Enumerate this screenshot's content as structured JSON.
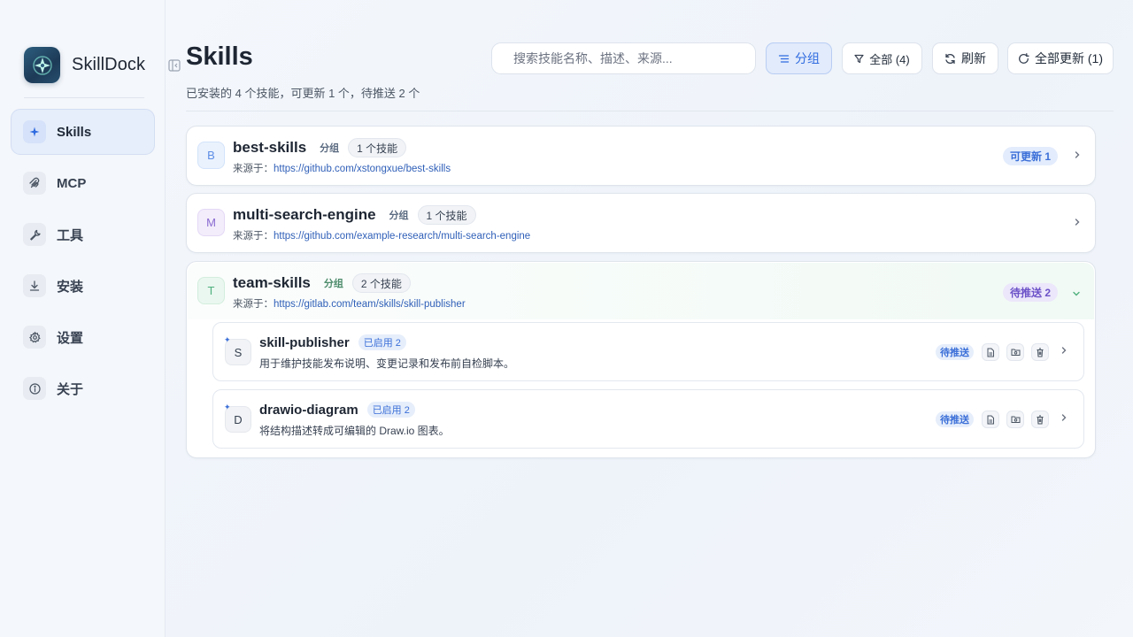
{
  "app": {
    "name": "SkillDock"
  },
  "sidebar": {
    "items": [
      {
        "label": "Skills",
        "icon": "sparkle-icon",
        "active": true
      },
      {
        "label": "MCP",
        "icon": "mcp-icon"
      },
      {
        "label": "工具",
        "icon": "wrench-icon"
      },
      {
        "label": "安装",
        "icon": "download-icon"
      },
      {
        "label": "设置",
        "icon": "gear-icon"
      },
      {
        "label": "关于",
        "icon": "info-icon"
      }
    ]
  },
  "header": {
    "title": "Skills",
    "subtitle": "已安装的 4 个技能，可更新 1 个，待推送 2 个"
  },
  "toolbar": {
    "search_placeholder": "搜索技能名称、描述、来源...",
    "group_label": "分组",
    "filter_label": "全部 (4)",
    "refresh_label": "刷新",
    "update_all_label": "全部更新 (1)"
  },
  "groups": [
    {
      "initial": "B",
      "name": "best-skills",
      "tag": "分组",
      "count": "1 个技能",
      "source_prefix": "来源于：",
      "source_url": "https://github.com/xstongxue/best-skills",
      "badge": "可更新 1",
      "expanded": false
    },
    {
      "initial": "M",
      "name": "multi-search-engine",
      "tag": "分组",
      "count": "1 个技能",
      "source_prefix": "来源于：",
      "source_url": "https://github.com/example-research/multi-search-engine",
      "expanded": false
    },
    {
      "initial": "T",
      "name": "team-skills",
      "tag": "分组",
      "count": "2 个技能",
      "source_prefix": "来源于：",
      "source_url": "https://gitlab.com/team/skills/skill-publisher",
      "badge": "待推送 2",
      "expanded": true,
      "skills": [
        {
          "initial": "S",
          "name": "skill-publisher",
          "enabled": "已启用 2",
          "description": "用于维护技能发布说明、变更记录和发布前自检脚本。",
          "status": "待推送"
        },
        {
          "initial": "D",
          "name": "drawio-diagram",
          "enabled": "已启用 2",
          "description": "将结构描述转成可编辑的 Draw.io 图表。",
          "status": "待推送"
        }
      ]
    }
  ],
  "colors": {
    "accent": "#2f6be0",
    "push_badge": "#6c52c8",
    "group_expanded": "#4fb07d"
  }
}
